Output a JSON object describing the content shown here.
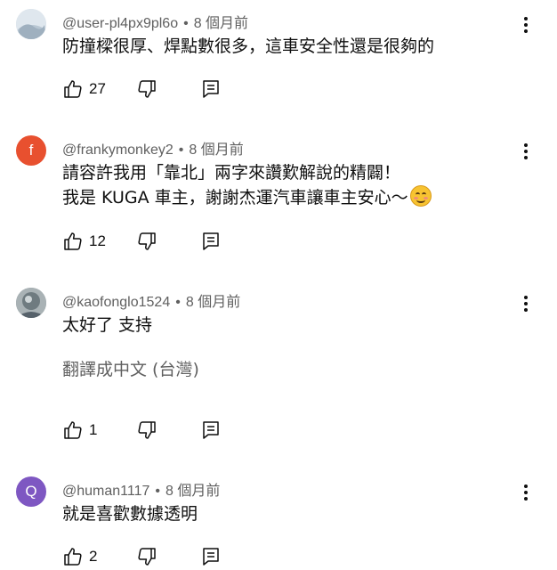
{
  "comments": [
    {
      "username": "@user-pl4px9pl6o",
      "time": "8 個月前",
      "lines": [
        "防撞樑很厚、焊點數很多，這車安全性還是很夠的"
      ],
      "likes": "27",
      "avatar_letter": "",
      "avatar_color": "#c7d3dc"
    },
    {
      "username": "@frankymonkey2",
      "time": "8 個月前",
      "lines": [
        "請容許我用「靠北」兩字來讚歎解說的精闢！",
        "我是 KUGA 車主，謝謝杰運汽車讓車主安心～"
      ],
      "likes": "12",
      "avatar_letter": "f",
      "avatar_color": "#e8502f",
      "emoji": "smiling-face-emoji"
    },
    {
      "username": "@kaofonglo1524",
      "time": "8 個月前",
      "lines": [
        "太好了 支持"
      ],
      "translate_label": "翻譯成中文 (台灣)",
      "likes": "1",
      "avatar_letter": "",
      "avatar_color": "#7d8a8f"
    },
    {
      "username": "@human1117",
      "time": "8 個月前",
      "lines": [
        "就是喜歡數據透明"
      ],
      "likes": "2",
      "avatar_letter": "Q",
      "avatar_color": "#7e57c2"
    }
  ],
  "icons": {
    "like": "thumbs-up-icon",
    "dislike": "thumbs-down-icon",
    "reply": "reply-icon",
    "more": "more-vert-icon"
  }
}
